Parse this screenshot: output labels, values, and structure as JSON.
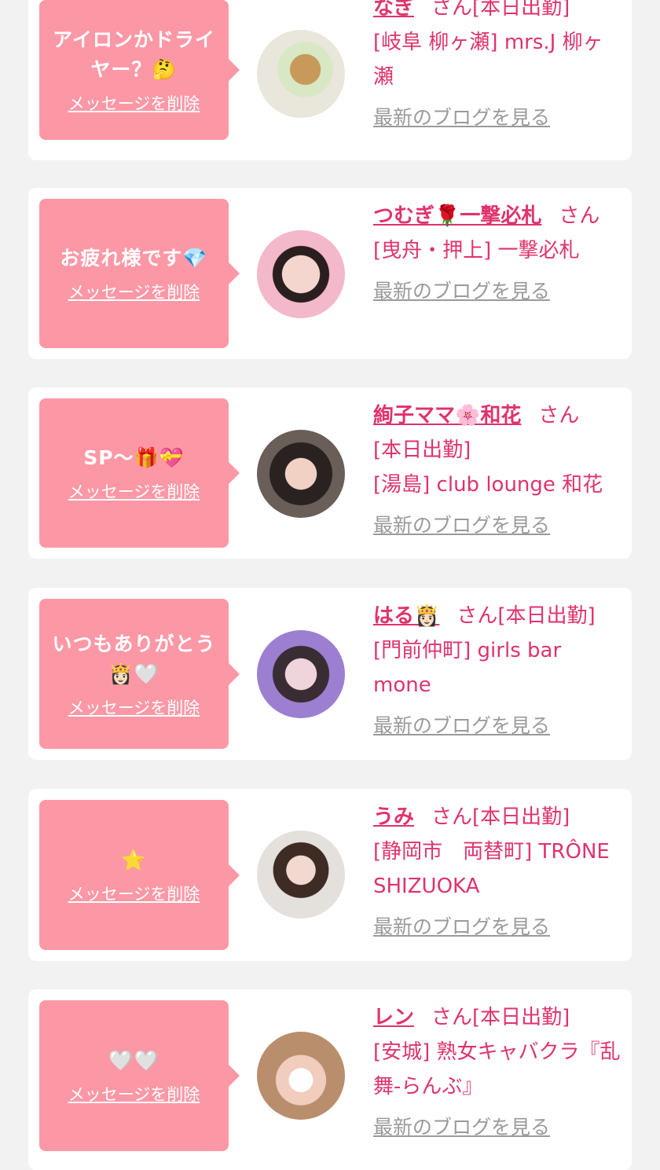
{
  "delete_label": "メッセージを削除",
  "blog_label": "最新のブログを見る",
  "san_label": "さん",
  "cards": [
    {
      "message": "アイロンかドライヤー？🤔",
      "name": "なぎ",
      "status": "[本日出勤]",
      "store": "[岐阜 柳ヶ瀬] mrs.J 柳ヶ瀬"
    },
    {
      "message": "お疲れ様です💎",
      "name": "つむぎ🌹一撃必札",
      "status": "",
      "store": "[曳舟・押上] 一撃必札"
    },
    {
      "message": "SP〜🎁💝",
      "name": "絢子ママ🌸和花",
      "status": "[本日出勤]",
      "store": "[湯島] club lounge 和花"
    },
    {
      "message": "いつもありがとう👸🏻🤍",
      "name": "はる👸🏻",
      "status": "[本日出勤]",
      "store": "[門前仲町] girls bar mone"
    },
    {
      "message": "⭐",
      "name": "うみ",
      "status": "[本日出勤]",
      "store": "[静岡市　両替町] TRÔNE SHIZUOKA"
    },
    {
      "message": "🤍🤍",
      "name": "レン",
      "status": "[本日出勤]",
      "store": "[安城] 熟女キャバクラ『乱舞-らんぶ』"
    }
  ]
}
